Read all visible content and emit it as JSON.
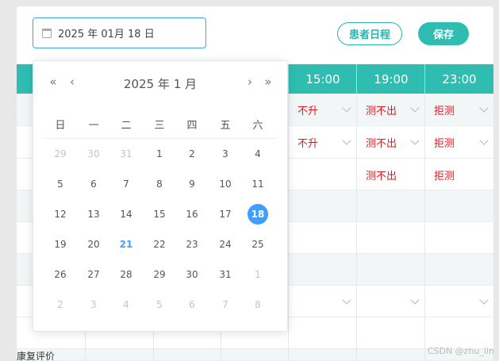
{
  "toolbar": {
    "date_value": "2025 年 01月 18 日",
    "schedule_button": "患者日程",
    "save_button": "保存"
  },
  "table": {
    "headers": [
      "15:00",
      "19:00",
      "23:00"
    ],
    "rows": [
      [
        "不升",
        "测不出",
        "拒测"
      ],
      [
        "不升",
        "测不出",
        "拒测"
      ],
      [
        "",
        "测不出",
        "拒测"
      ]
    ],
    "bottom_label": "康复评价"
  },
  "datepicker": {
    "title": "2025 年  1 月",
    "prev_year": "«",
    "prev_month": "‹",
    "next_month": "›",
    "next_year": "»",
    "weekdays": [
      "日",
      "一",
      "二",
      "三",
      "四",
      "五",
      "六"
    ],
    "weeks": [
      [
        "29",
        "30",
        "31",
        "1",
        "2",
        "3",
        "4"
      ],
      [
        "5",
        "6",
        "7",
        "8",
        "9",
        "10",
        "11"
      ],
      [
        "12",
        "13",
        "14",
        "15",
        "16",
        "17",
        "18"
      ],
      [
        "19",
        "20",
        "21",
        "22",
        "23",
        "24",
        "25"
      ],
      [
        "26",
        "27",
        "28",
        "29",
        "30",
        "31",
        "1"
      ],
      [
        "2",
        "3",
        "4",
        "5",
        "6",
        "7",
        "8"
      ]
    ],
    "selected_day": "18",
    "today_day": "21"
  },
  "watermark": "CSDN @zhu_lin",
  "colors": {
    "teal": "#2fbdb2",
    "blue": "#409eff",
    "red": "#e0171f"
  }
}
